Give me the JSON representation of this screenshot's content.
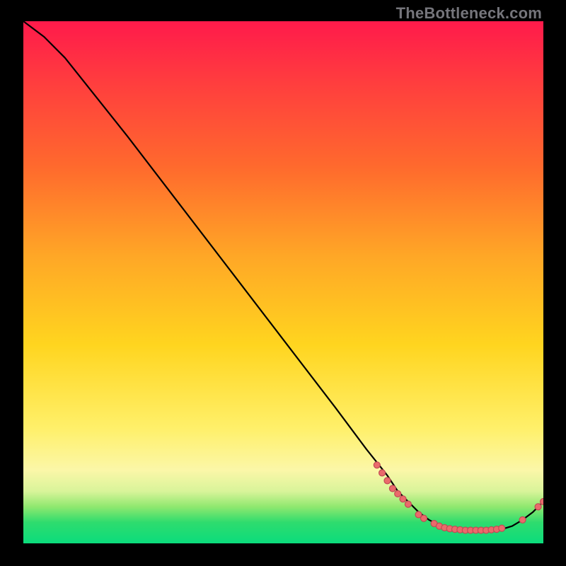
{
  "watermark": "TheBottleneck.com",
  "colors": {
    "background": "#000000",
    "gradient_top": "#ff1a4b",
    "gradient_mid": "#ffd51f",
    "gradient_bottom": "#0bdc7c",
    "line": "#000000",
    "marker_fill": "#ea6a6b",
    "marker_stroke": "#c24a55"
  },
  "chart_data": {
    "type": "line",
    "title": "",
    "xlabel": "",
    "ylabel": "",
    "xlim": [
      0,
      100
    ],
    "ylim": [
      0,
      100
    ],
    "grid": false,
    "legend": false,
    "x": [
      0,
      4,
      8,
      12,
      20,
      30,
      40,
      50,
      60,
      66,
      70,
      72,
      74,
      76,
      78,
      80,
      82,
      84,
      86,
      88,
      90,
      92,
      94,
      96,
      98,
      100
    ],
    "values": [
      100,
      97,
      93,
      88,
      78,
      65,
      52,
      39,
      26,
      18,
      13,
      10,
      8,
      6,
      4.5,
      3.5,
      3,
      2.7,
      2.5,
      2.5,
      2.5,
      2.7,
      3.3,
      4.5,
      6,
      8
    ],
    "markers": [
      {
        "x": 68,
        "y": 15
      },
      {
        "x": 69,
        "y": 13.5
      },
      {
        "x": 70,
        "y": 12
      },
      {
        "x": 71,
        "y": 10.5
      },
      {
        "x": 72,
        "y": 9.5
      },
      {
        "x": 73,
        "y": 8.5
      },
      {
        "x": 74,
        "y": 7.5
      },
      {
        "x": 76,
        "y": 5.5
      },
      {
        "x": 77,
        "y": 4.8
      },
      {
        "x": 79,
        "y": 3.8
      },
      {
        "x": 80,
        "y": 3.3
      },
      {
        "x": 81,
        "y": 3.0
      },
      {
        "x": 82,
        "y": 2.8
      },
      {
        "x": 83,
        "y": 2.7
      },
      {
        "x": 84,
        "y": 2.6
      },
      {
        "x": 85,
        "y": 2.5
      },
      {
        "x": 86,
        "y": 2.5
      },
      {
        "x": 87,
        "y": 2.5
      },
      {
        "x": 88,
        "y": 2.5
      },
      {
        "x": 89,
        "y": 2.5
      },
      {
        "x": 90,
        "y": 2.6
      },
      {
        "x": 91,
        "y": 2.7
      },
      {
        "x": 92,
        "y": 2.9
      },
      {
        "x": 96,
        "y": 4.5
      },
      {
        "x": 99,
        "y": 7.0
      },
      {
        "x": 100,
        "y": 8.0
      }
    ]
  }
}
